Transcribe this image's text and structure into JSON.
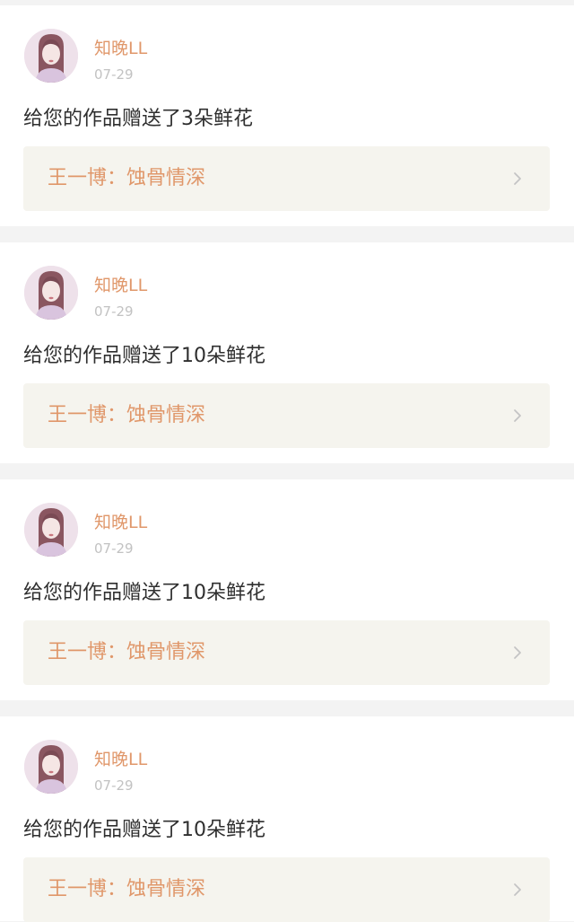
{
  "notifications": [
    {
      "user": "知晚LL",
      "date": "07-29",
      "message": "给您的作品赠送了3朵鲜花",
      "work": "王一博：蚀骨情深"
    },
    {
      "user": "知晚LL",
      "date": "07-29",
      "message": "给您的作品赠送了10朵鲜花",
      "work": "王一博：蚀骨情深"
    },
    {
      "user": "知晚LL",
      "date": "07-29",
      "message": "给您的作品赠送了10朵鲜花",
      "work": "王一博：蚀骨情深"
    },
    {
      "user": "知晚LL",
      "date": "07-29",
      "message": "给您的作品赠送了10朵鲜花",
      "work": "王一博：蚀骨情深"
    }
  ],
  "icons": {
    "avatar": "avatar-image",
    "chevron": "chevron-right-icon"
  },
  "colors": {
    "background": "#f3f3f3",
    "card": "#ffffff",
    "accent": "#e0976a",
    "muted": "#c2c2c2",
    "text": "#2f2f2f",
    "link_bg": "#f5f4ee"
  }
}
